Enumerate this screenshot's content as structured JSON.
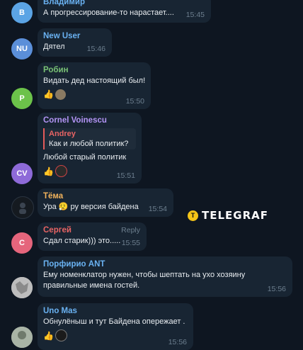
{
  "messages": [
    {
      "id": "m1",
      "author": "Владимир",
      "author_color": "#6ab2f2",
      "avatar_initials": "В",
      "avatar_color": "#5ba4e5",
      "text": "А прогрессирование-то нарастает....",
      "time": "15:45"
    },
    {
      "id": "m2",
      "author": "New User",
      "author_color": "#6ab2f2",
      "avatar_initials": "NU",
      "avatar_color": "#5b8fd9",
      "text": "Дятел",
      "time": "15:46"
    },
    {
      "id": "m3",
      "author": "Робин",
      "author_color": "#79c275",
      "avatar_initials": "Р",
      "avatar_color": "#6cc24a",
      "text": "Видать дед настоящий был!",
      "time": "15:50",
      "reactions": [
        "thumbs-up",
        "avatar"
      ]
    },
    {
      "id": "m4",
      "author": "Cornel Voinescu",
      "author_color": "#b394f5",
      "avatar_initials": "CV",
      "avatar_color": "#8e6ad8",
      "quote": {
        "author": "Andrey",
        "text": "Как и любой политик?"
      },
      "text": "Любой старый политик",
      "time": "15:51",
      "reactions": [
        "thumbs-up",
        "avatar"
      ]
    },
    {
      "id": "m5",
      "author": "Тёма",
      "author_color": "#f2b35c",
      "text": "Ура 😮‍💨 ру версия байдена",
      "time": "15:54"
    },
    {
      "id": "m6",
      "author": "Сергей",
      "author_color": "#e86464",
      "avatar_initials": "С",
      "avatar_color": "#e5657c",
      "reply_label": "Reply",
      "text": "Сдал старик))) это.....",
      "time": "15:55"
    },
    {
      "id": "m7",
      "author": "Порфирио ANT",
      "author_color": "#6ab2f2",
      "text_lines": [
        "Ему номенклатор нужен, чтобы шептать на ухо хозяину",
        "правильные имена гостей."
      ],
      "time": "15:56"
    },
    {
      "id": "m8",
      "author": "Uno Mas",
      "author_color": "#6ab2f2",
      "text": "Обнулёныш и тут Байдена опережает .",
      "time": "15:56",
      "reactions": [
        "thumbs-up",
        "avatar"
      ]
    }
  ],
  "watermark": {
    "symbol": "T",
    "text": "TELEGRAF"
  },
  "icons": {
    "thumbs_up": "👍"
  }
}
